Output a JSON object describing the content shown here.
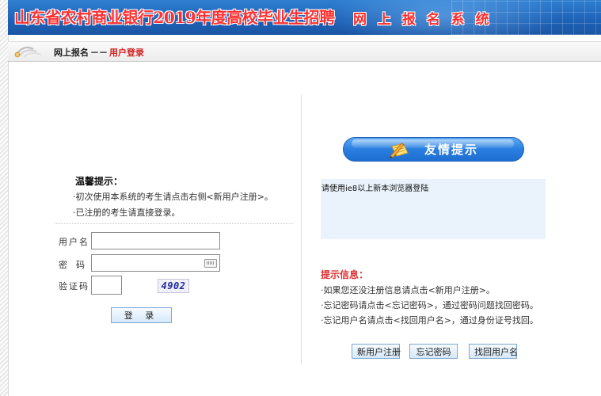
{
  "header": {
    "title": "山东省农村商业银行2019年度高校毕业生招聘",
    "subtitle": "网 上 报 名 系 统"
  },
  "breadcrumb": {
    "root": "网上报名",
    "separator": "－－",
    "current": "用户登录"
  },
  "left_panel": {
    "tips_title": "温馨提示：",
    "tips": [
      "·初次使用本系统的考生请点击右侧<新用户注册>。",
      "·已注册的考生请直接登录。"
    ],
    "form": {
      "username_label": "用户名",
      "password_label": "密　码",
      "captcha_label": "验证码",
      "username_value": "",
      "password_value": "",
      "captcha_value": "",
      "captcha_image_text": "4902",
      "keyboard_icon": "keyboard-icon"
    },
    "login_button": "登 录"
  },
  "right_panel": {
    "friendly_title": "友情提示",
    "friendly_icon": "pen-paper-icon",
    "notice": "请使用ie8以上新本浏览器登陆",
    "info_title": "提示信息：",
    "info_lines": [
      "·如果您还没注册信息请点击<新用户注册>。",
      "·忘记密码请点击<忘记密码>，通过密码问题找回密码。",
      "·忘记用户名请点击<找回用户名>，通过身份证号找回。"
    ],
    "buttons": {
      "register": "新用户注册",
      "forgot_password": "忘记密码",
      "find_username": "找回用户名"
    }
  },
  "colors": {
    "banner_blue": "#1f63b8",
    "title_red": "#ff3030",
    "info_red": "#e03030",
    "notice_bg": "#eaf3fb"
  }
}
